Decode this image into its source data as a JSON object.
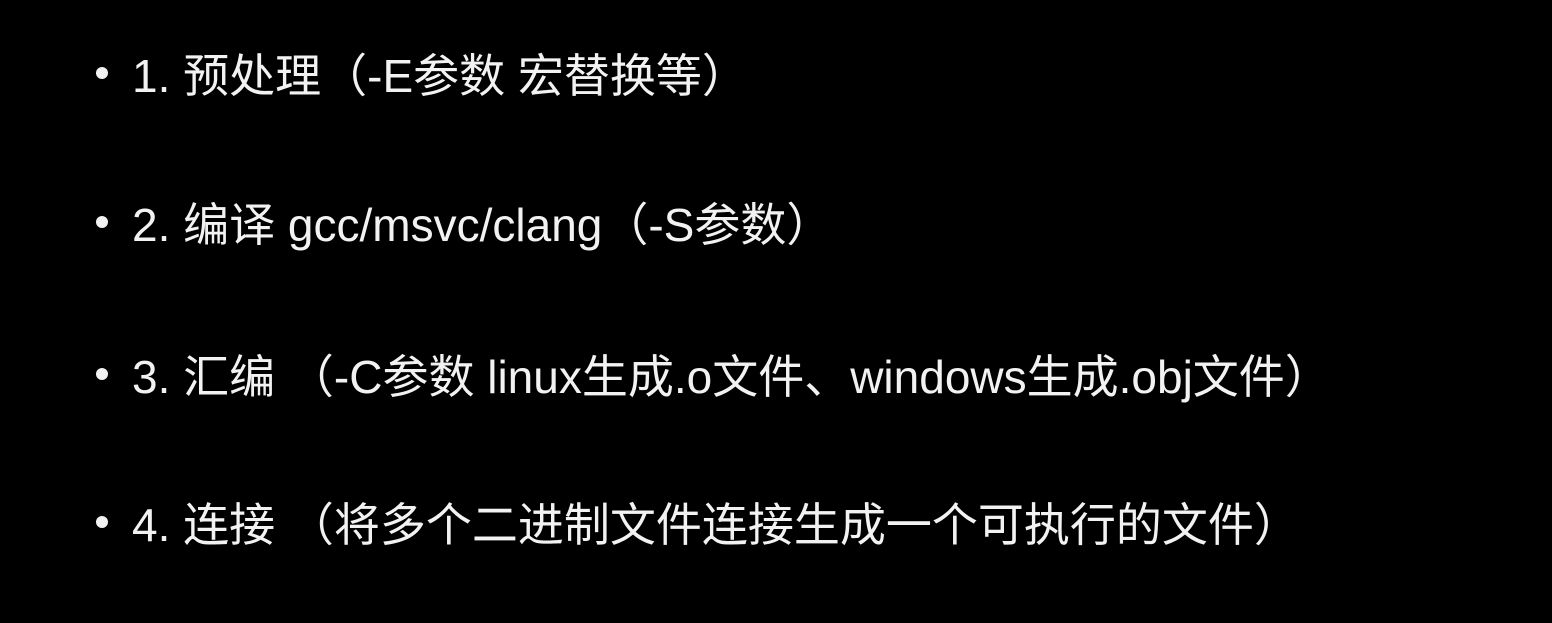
{
  "slide": {
    "items": [
      {
        "text": "1. 预处理（-E参数 宏替换等）"
      },
      {
        "text": "2. 编译 gcc/msvc/clang（-S参数）"
      },
      {
        "text": "3. 汇编 （-C参数 linux生成.o文件、windows生成.obj文件）"
      },
      {
        "text": "4. 连接 （将多个二进制文件连接生成一个可执行的文件）"
      }
    ]
  }
}
